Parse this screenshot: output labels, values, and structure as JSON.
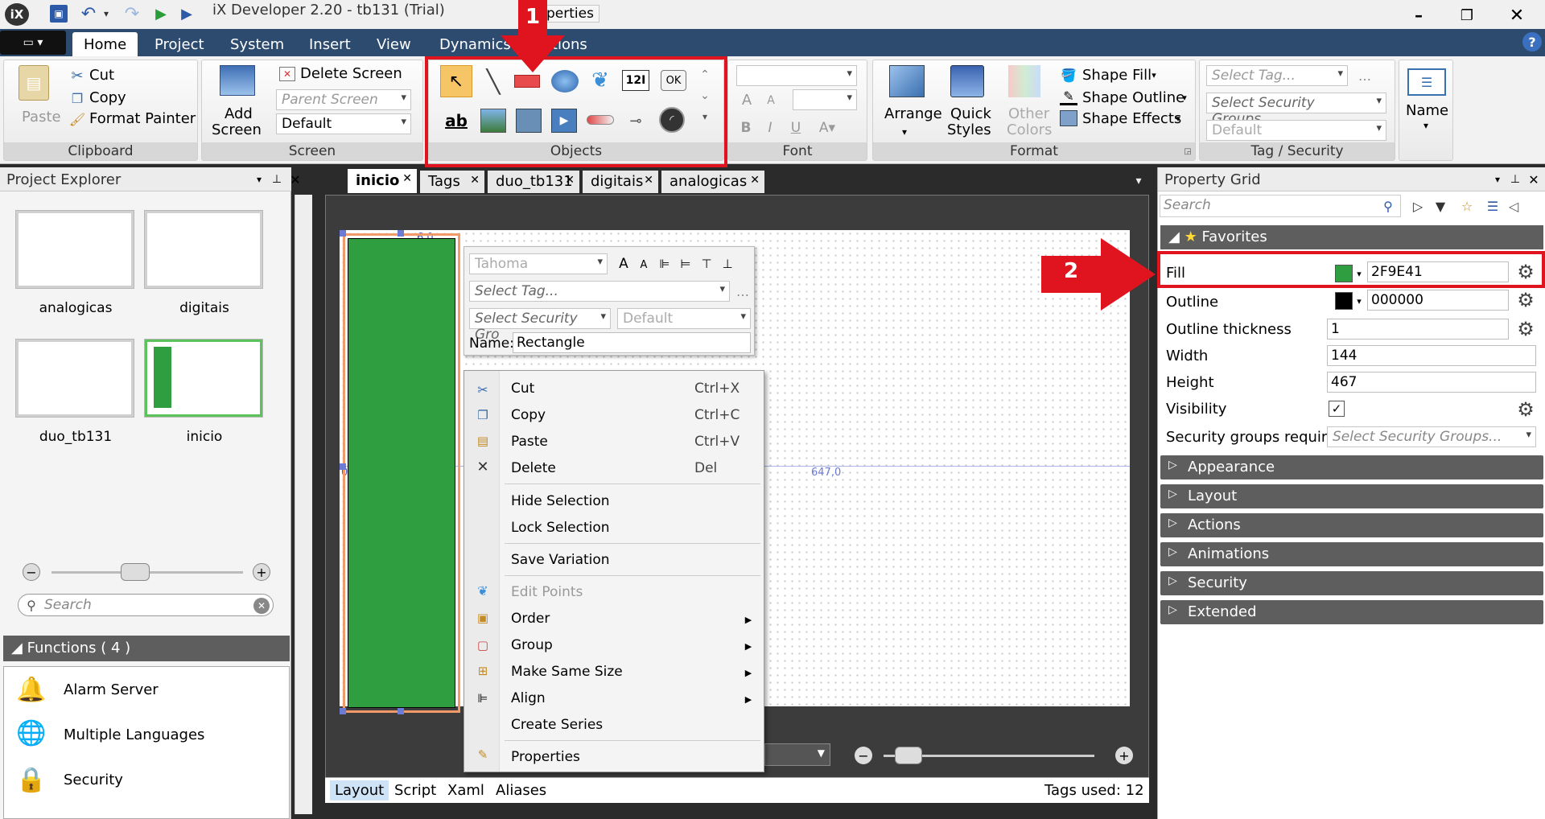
{
  "title": "iX Developer 2.20 - tb131 (Trial)",
  "title_overlap": "perties",
  "ribbon_tabs": [
    "Home",
    "Project",
    "System",
    "Insert",
    "View",
    "Dynamics",
    "Actions"
  ],
  "clipboard": {
    "paste": "Paste",
    "cut": "Cut",
    "copy": "Copy",
    "format_painter": "Format Painter",
    "label": "Clipboard"
  },
  "screen": {
    "add_screen": "Add",
    "add_screen2": "Screen",
    "delete_screen": "Delete Screen",
    "parent_screen": "Parent Screen",
    "default": "Default",
    "label": "Screen"
  },
  "objects": {
    "label": "Objects",
    "btn_12": "12I",
    "btn_ok": "OK",
    "btn_ab": "ab"
  },
  "font_group": {
    "label": "Font"
  },
  "format": {
    "arrange": "Arrange",
    "quick": "Quick",
    "styles": "Styles",
    "other": "Other",
    "colors": "Colors",
    "shape_fill": "Shape Fill",
    "shape_outline": "Shape Outline",
    "shape_effects": "Shape Effects",
    "label": "Format"
  },
  "tag_security": {
    "select_tag": "Select Tag...",
    "select_security": "Select Security Groups...",
    "default": "Default",
    "name": "Name",
    "label": "Tag / Security"
  },
  "annotations": {
    "one": "1",
    "two": "2"
  },
  "project_explorer": {
    "title": "Project Explorer",
    "screens": [
      "analogicas",
      "digitais",
      "duo_tb131",
      "inicio"
    ],
    "search_placeholder": "Search",
    "functions_title": "Functions ( 4 )",
    "functions": [
      "Alarm Server",
      "Multiple Languages",
      "Security"
    ]
  },
  "doc_tabs": [
    "inicio",
    "Tags",
    "duo_tb131",
    "digitais",
    "analogicas"
  ],
  "canvas": {
    "coord1": "6,0",
    "coord2": "0,0",
    "coord3": "647,0"
  },
  "mini_toolbar": {
    "font": "Tahoma",
    "select_tag": "Select Tag...",
    "select_security": "Select Security Gro",
    "default": "Default",
    "name_label": "Name:",
    "name_value": "Rectangle"
  },
  "context_menu": [
    {
      "label": "Cut",
      "shortcut": "Ctrl+X"
    },
    {
      "label": "Copy",
      "shortcut": "Ctrl+C"
    },
    {
      "label": "Paste",
      "shortcut": "Ctrl+V"
    },
    {
      "label": "Delete",
      "shortcut": "Del"
    },
    {
      "label": "Hide Selection"
    },
    {
      "label": "Lock Selection"
    },
    {
      "label": "Save Variation"
    },
    {
      "label": "Edit Points"
    },
    {
      "label": "Order"
    },
    {
      "label": "Group"
    },
    {
      "label": "Make Same Size"
    },
    {
      "label": "Align"
    },
    {
      "label": "Create Series"
    },
    {
      "label": "Properties"
    }
  ],
  "bottom_tabs": [
    "Layout",
    "Script",
    "Xaml",
    "Aliases"
  ],
  "tags_used": "Tags used: 12",
  "property_grid": {
    "title": "Property Grid",
    "search_placeholder": "Search",
    "favorites": "Favorites",
    "fill_label": "Fill",
    "fill_value": "2F9E41",
    "fill_color": "#2f9e41",
    "outline_label": "Outline",
    "outline_value": "000000",
    "outline_color": "#000000",
    "outline_thickness_label": "Outline thickness",
    "outline_thickness_value": "1",
    "width_label": "Width",
    "width_value": "144",
    "height_label": "Height",
    "height_value": "467",
    "visibility_label": "Visibility",
    "security_label": "Security groups required",
    "security_value": "Select Security Groups...",
    "categories": [
      "Appearance",
      "Layout",
      "Actions",
      "Animations",
      "Security",
      "Extended"
    ]
  }
}
